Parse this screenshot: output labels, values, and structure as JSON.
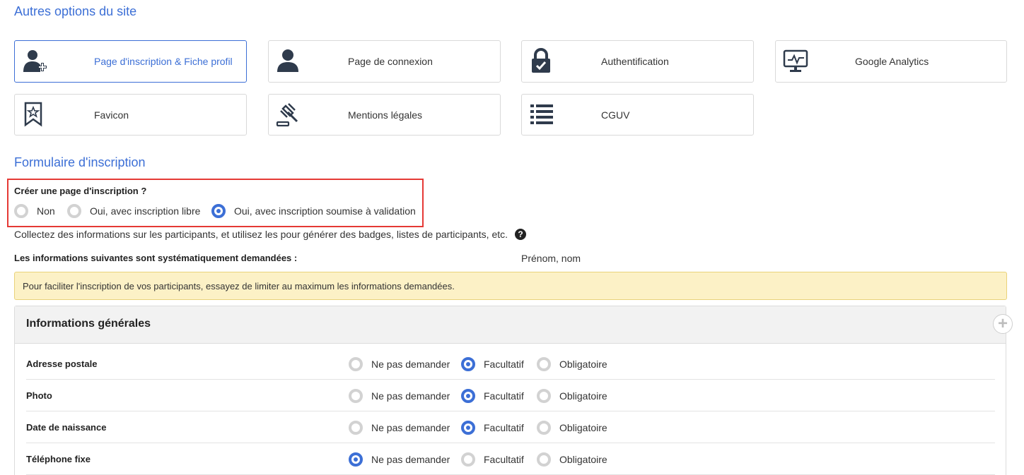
{
  "sections": {
    "site_options_title": "Autres options du site",
    "form_title": "Formulaire d'inscription"
  },
  "cards": [
    {
      "label": "Page d'inscription & Fiche profil",
      "icon": "user-plus-icon",
      "active": true
    },
    {
      "label": "Page de connexion",
      "icon": "user-icon",
      "active": false
    },
    {
      "label": "Authentification",
      "icon": "lock-check-icon",
      "active": false
    },
    {
      "label": "Google Analytics",
      "icon": "monitor-chart-icon",
      "active": false
    },
    {
      "label": "Favicon",
      "icon": "bookmark-star-icon",
      "active": false
    },
    {
      "label": "Mentions légales",
      "icon": "gavel-icon",
      "active": false
    },
    {
      "label": "CGUV",
      "icon": "list-icon",
      "active": false
    }
  ],
  "registration": {
    "question": "Créer une page d'inscription ?",
    "options": [
      "Non",
      "Oui, avec inscription libre",
      "Oui, avec inscription soumise à validation"
    ],
    "selected": "Oui, avec inscription soumise à validation",
    "description": "Collectez des informations sur les participants, et utilisez les pour générer des badges, listes de participants, etc.",
    "help_icon": "question-circle-icon"
  },
  "system_info": {
    "label": "Les informations suivantes sont systématiquement demandées :",
    "value": "Prénom, nom"
  },
  "alert": "Pour faciliter l'inscription de vos participants, essayez de limiter au maximum les informations demandées.",
  "panel": {
    "title": "Informations générales",
    "add_icon": "plus-icon",
    "choices": [
      "Ne pas demander",
      "Facultatif",
      "Obligatoire"
    ],
    "rows": [
      {
        "label": "Adresse postale",
        "selected": "Facultatif"
      },
      {
        "label": "Photo",
        "selected": "Facultatif"
      },
      {
        "label": "Date de naissance",
        "selected": "Facultatif"
      },
      {
        "label": "Téléphone fixe",
        "selected": "Ne pas demander"
      }
    ]
  },
  "colors": {
    "accent": "#3c6fd6",
    "alert_bg": "#fcf1c6",
    "highlight": "#e53935"
  }
}
